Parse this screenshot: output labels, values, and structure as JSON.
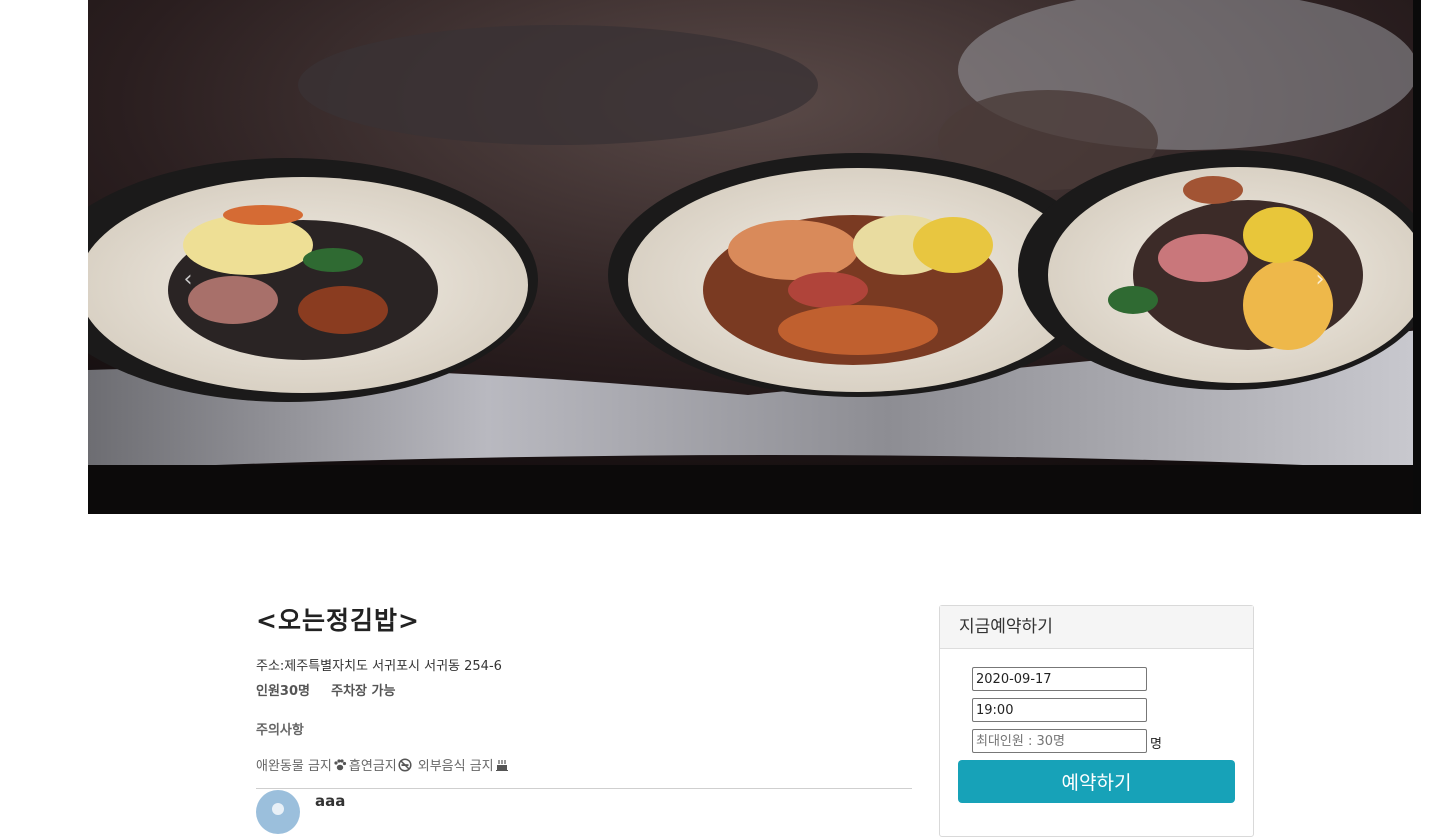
{
  "carousel": {
    "prev_icon": "chevron-left-icon",
    "next_icon": "chevron-right-icon",
    "prev_glyph": "‹",
    "next_glyph": "›"
  },
  "restaurant": {
    "title": "<오는정김밥>",
    "address": "주소:제주특별자치도 서귀포시 서귀동 254-6",
    "capacity_prefix": "인원",
    "capacity_value": "30명",
    "parking": "주차장 가능",
    "notice_heading": "주의사항",
    "rules": [
      {
        "text": "애완동물 금지",
        "icon": "paw-icon"
      },
      {
        "text": "흡연금지",
        "icon": "no-smoking-icon"
      },
      {
        "text": "외부음식 금지",
        "icon": "food-icon"
      }
    ]
  },
  "review": {
    "user": "aaa"
  },
  "booking": {
    "heading": "지금예약하기",
    "date_value": "2020-09-17",
    "time_value": "19:00",
    "people_placeholder": "최대인원 : 30명",
    "unit": "명",
    "submit_label": "예약하기",
    "accent_color": "#17a2b8"
  }
}
